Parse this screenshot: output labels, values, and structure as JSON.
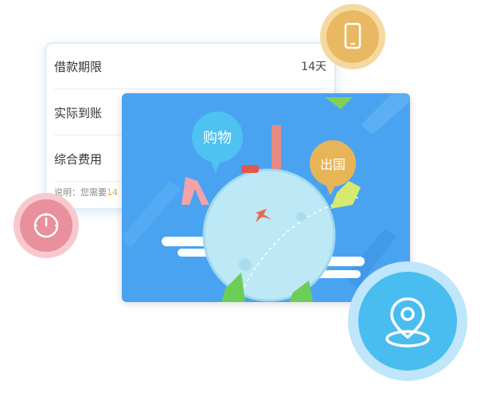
{
  "card": {
    "rows": [
      {
        "label": "借款期限",
        "value": "14天"
      },
      {
        "label": "实际到账",
        "value": ""
      },
      {
        "label": "综合费用",
        "value": ""
      }
    ],
    "note_prefix": "说明：您需要",
    "note_value": "14"
  },
  "illustration": {
    "bubble_left": "购物",
    "bubble_right": "出国"
  },
  "icons": {
    "phone": "phone-icon",
    "gauge": "gauge-icon",
    "pin": "location-pin-icon"
  },
  "colors": {
    "phone_outer": "#f5d9a0",
    "phone_inner": "#e9b862",
    "gauge_outer": "#f7c9cf",
    "gauge_inner": "#e8919c",
    "pin_outer": "#bfe6fb",
    "pin_inner": "#49bdf0",
    "scene_bg": "#4aa3f1"
  }
}
